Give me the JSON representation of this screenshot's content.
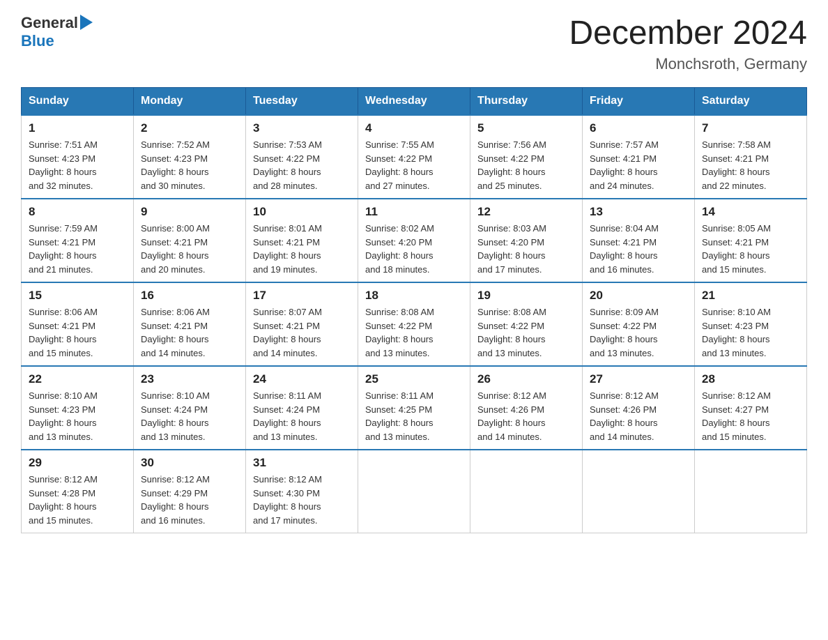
{
  "header": {
    "logo_general": "General",
    "logo_blue": "Blue",
    "title": "December 2024",
    "subtitle": "Monchsroth, Germany"
  },
  "days_of_week": [
    "Sunday",
    "Monday",
    "Tuesday",
    "Wednesday",
    "Thursday",
    "Friday",
    "Saturday"
  ],
  "weeks": [
    [
      {
        "day": "1",
        "sunrise": "7:51 AM",
        "sunset": "4:23 PM",
        "daylight": "8 hours and 32 minutes."
      },
      {
        "day": "2",
        "sunrise": "7:52 AM",
        "sunset": "4:23 PM",
        "daylight": "8 hours and 30 minutes."
      },
      {
        "day": "3",
        "sunrise": "7:53 AM",
        "sunset": "4:22 PM",
        "daylight": "8 hours and 28 minutes."
      },
      {
        "day": "4",
        "sunrise": "7:55 AM",
        "sunset": "4:22 PM",
        "daylight": "8 hours and 27 minutes."
      },
      {
        "day": "5",
        "sunrise": "7:56 AM",
        "sunset": "4:22 PM",
        "daylight": "8 hours and 25 minutes."
      },
      {
        "day": "6",
        "sunrise": "7:57 AM",
        "sunset": "4:21 PM",
        "daylight": "8 hours and 24 minutes."
      },
      {
        "day": "7",
        "sunrise": "7:58 AM",
        "sunset": "4:21 PM",
        "daylight": "8 hours and 22 minutes."
      }
    ],
    [
      {
        "day": "8",
        "sunrise": "7:59 AM",
        "sunset": "4:21 PM",
        "daylight": "8 hours and 21 minutes."
      },
      {
        "day": "9",
        "sunrise": "8:00 AM",
        "sunset": "4:21 PM",
        "daylight": "8 hours and 20 minutes."
      },
      {
        "day": "10",
        "sunrise": "8:01 AM",
        "sunset": "4:21 PM",
        "daylight": "8 hours and 19 minutes."
      },
      {
        "day": "11",
        "sunrise": "8:02 AM",
        "sunset": "4:20 PM",
        "daylight": "8 hours and 18 minutes."
      },
      {
        "day": "12",
        "sunrise": "8:03 AM",
        "sunset": "4:20 PM",
        "daylight": "8 hours and 17 minutes."
      },
      {
        "day": "13",
        "sunrise": "8:04 AM",
        "sunset": "4:21 PM",
        "daylight": "8 hours and 16 minutes."
      },
      {
        "day": "14",
        "sunrise": "8:05 AM",
        "sunset": "4:21 PM",
        "daylight": "8 hours and 15 minutes."
      }
    ],
    [
      {
        "day": "15",
        "sunrise": "8:06 AM",
        "sunset": "4:21 PM",
        "daylight": "8 hours and 15 minutes."
      },
      {
        "day": "16",
        "sunrise": "8:06 AM",
        "sunset": "4:21 PM",
        "daylight": "8 hours and 14 minutes."
      },
      {
        "day": "17",
        "sunrise": "8:07 AM",
        "sunset": "4:21 PM",
        "daylight": "8 hours and 14 minutes."
      },
      {
        "day": "18",
        "sunrise": "8:08 AM",
        "sunset": "4:22 PM",
        "daylight": "8 hours and 13 minutes."
      },
      {
        "day": "19",
        "sunrise": "8:08 AM",
        "sunset": "4:22 PM",
        "daylight": "8 hours and 13 minutes."
      },
      {
        "day": "20",
        "sunrise": "8:09 AM",
        "sunset": "4:22 PM",
        "daylight": "8 hours and 13 minutes."
      },
      {
        "day": "21",
        "sunrise": "8:10 AM",
        "sunset": "4:23 PM",
        "daylight": "8 hours and 13 minutes."
      }
    ],
    [
      {
        "day": "22",
        "sunrise": "8:10 AM",
        "sunset": "4:23 PM",
        "daylight": "8 hours and 13 minutes."
      },
      {
        "day": "23",
        "sunrise": "8:10 AM",
        "sunset": "4:24 PM",
        "daylight": "8 hours and 13 minutes."
      },
      {
        "day": "24",
        "sunrise": "8:11 AM",
        "sunset": "4:24 PM",
        "daylight": "8 hours and 13 minutes."
      },
      {
        "day": "25",
        "sunrise": "8:11 AM",
        "sunset": "4:25 PM",
        "daylight": "8 hours and 13 minutes."
      },
      {
        "day": "26",
        "sunrise": "8:12 AM",
        "sunset": "4:26 PM",
        "daylight": "8 hours and 14 minutes."
      },
      {
        "day": "27",
        "sunrise": "8:12 AM",
        "sunset": "4:26 PM",
        "daylight": "8 hours and 14 minutes."
      },
      {
        "day": "28",
        "sunrise": "8:12 AM",
        "sunset": "4:27 PM",
        "daylight": "8 hours and 15 minutes."
      }
    ],
    [
      {
        "day": "29",
        "sunrise": "8:12 AM",
        "sunset": "4:28 PM",
        "daylight": "8 hours and 15 minutes."
      },
      {
        "day": "30",
        "sunrise": "8:12 AM",
        "sunset": "4:29 PM",
        "daylight": "8 hours and 16 minutes."
      },
      {
        "day": "31",
        "sunrise": "8:12 AM",
        "sunset": "4:30 PM",
        "daylight": "8 hours and 17 minutes."
      },
      null,
      null,
      null,
      null
    ]
  ],
  "labels": {
    "sunrise": "Sunrise:",
    "sunset": "Sunset:",
    "daylight": "Daylight:"
  }
}
